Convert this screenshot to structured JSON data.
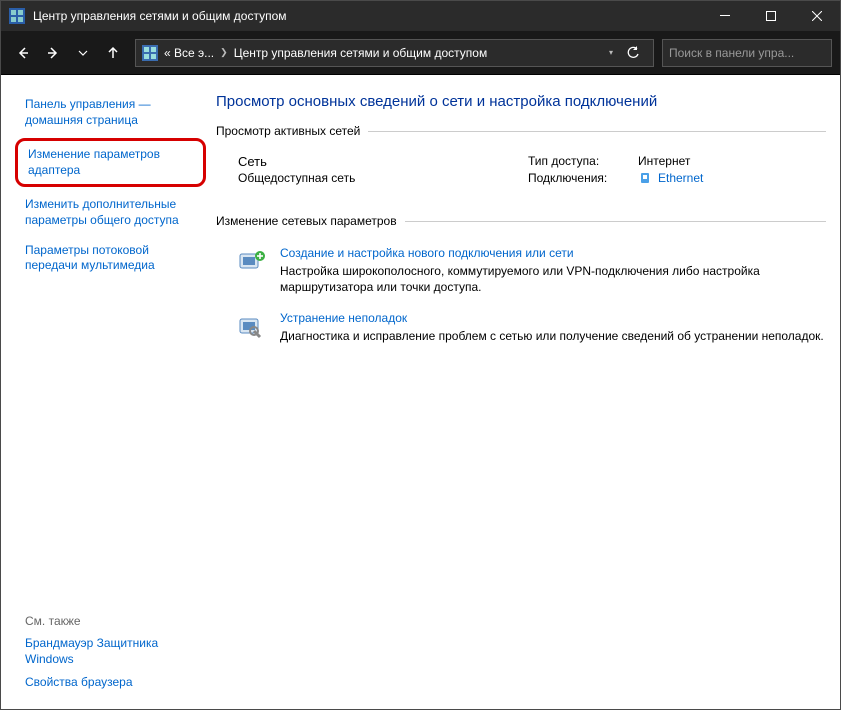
{
  "window": {
    "title": "Центр управления сетями и общим доступом"
  },
  "address": {
    "crumb1": "« Все э...",
    "crumb2": "Центр управления сетями и общим доступом"
  },
  "search": {
    "placeholder": "Поиск в панели упра..."
  },
  "sidebar": {
    "item0": "Панель управления — домашняя страница",
    "item1": "Изменение параметров адаптера",
    "item2": "Изменить дополнительные параметры общего доступа",
    "item3": "Параметры потоковой передачи мультимедиа",
    "footer_label": "См. также",
    "footer_item0": "Брандмауэр Защитника Windows",
    "footer_item1": "Свойства браузера"
  },
  "main": {
    "heading": "Просмотр основных сведений о сети и настройка подключений",
    "fieldset_active": "Просмотр активных сетей",
    "net_name": "Сеть",
    "net_type": "Общедоступная сеть",
    "access_label": "Тип доступа:",
    "access_value": "Интернет",
    "conn_label": "Подключения:",
    "conn_value": "Ethernet",
    "fieldset_params": "Изменение сетевых параметров",
    "param1_title": "Создание и настройка нового подключения или сети",
    "param1_desc": "Настройка широкополосного, коммутируемого или VPN-подключения либо настройка маршрутизатора или точки доступа.",
    "param2_title": "Устранение неполадок",
    "param2_desc": "Диагностика и исправление проблем с сетью или получение сведений об устранении неполадок."
  }
}
